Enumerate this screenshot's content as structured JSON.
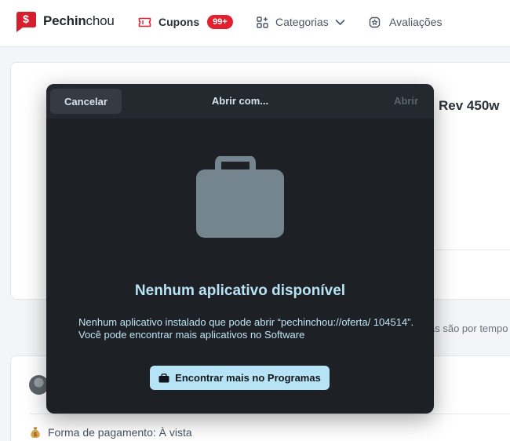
{
  "topbar": {
    "brand_bold": "Pechin",
    "brand_light": "chou",
    "logo_glyph": "$",
    "nav": {
      "cupons_label": "Cupons",
      "cupons_badge": "99+",
      "categorias_label": "Categorias",
      "avaliacoes_label": "Avaliações"
    }
  },
  "background": {
    "product_title_fragment": "Rev 450w",
    "note_fragment": "as são por tempo",
    "payment_label": "Forma de pagamento: À vista"
  },
  "dialog": {
    "cancel_label": "Cancelar",
    "title": "Abrir com...",
    "open_label": "Abrir",
    "heading": "Nenhum aplicativo disponível",
    "description": "Nenhum aplicativo instalado que pode abrir “pechinchou://oferta/ 104514”. Você pode encontrar mais aplicativos no Software",
    "find_more_label": "Encontrar mais no Programas"
  },
  "icons": {
    "logo": "pechinchou-logo-icon",
    "cupons": "ticket-icon",
    "categorias": "grid-icon",
    "categorias_chevron": "chevron-down-icon",
    "avaliacoes": "star-badge-icon",
    "payment": "money-bag-icon",
    "dialog_main": "shopping-bag-icon",
    "find_more": "shopping-bag-icon"
  },
  "colors": {
    "brand_red": "#e2202f",
    "dialog_bg": "#1d2126",
    "dialog_accent": "#b7e3f6"
  }
}
